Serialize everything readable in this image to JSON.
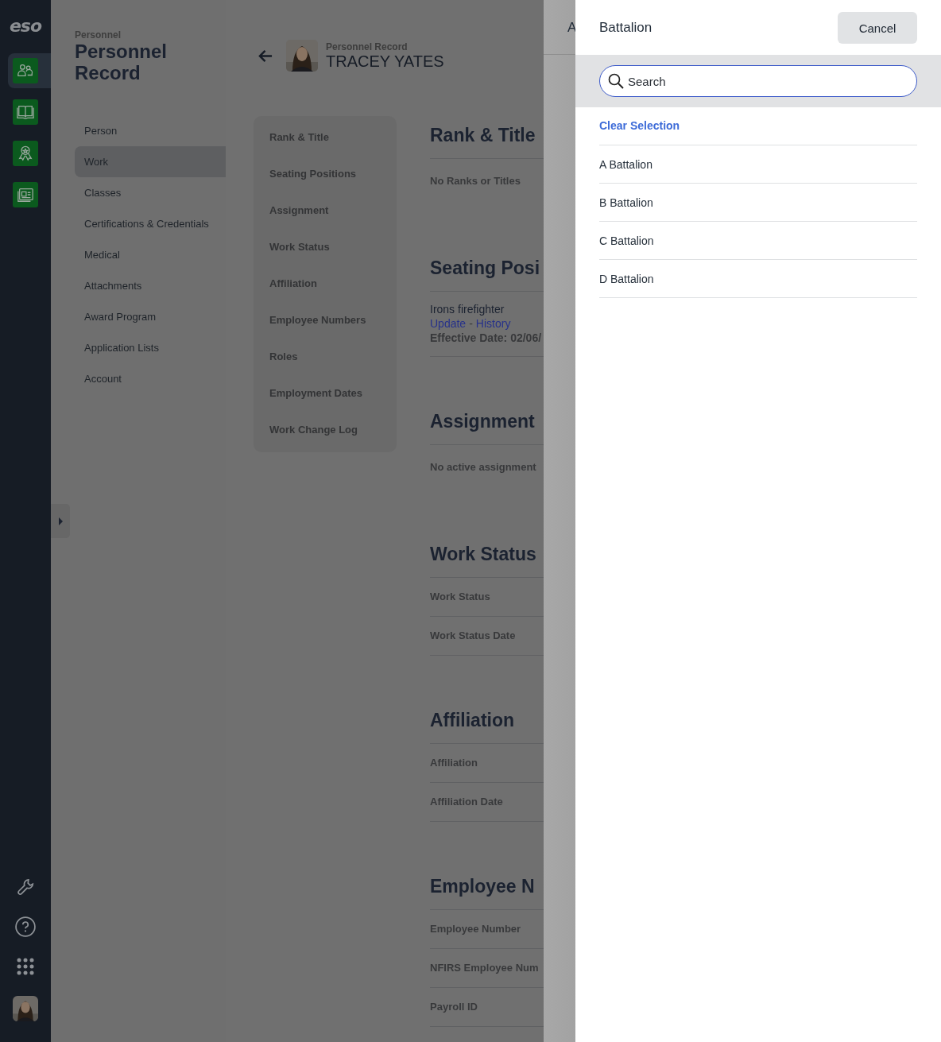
{
  "rail": {
    "logo": "eso",
    "apps": [
      {
        "selected": true
      },
      {
        "selected": false
      },
      {
        "selected": false
      },
      {
        "selected": false
      }
    ]
  },
  "subnav": {
    "eyebrow": "Personnel",
    "title": "Personnel Record",
    "items": [
      {
        "label": "Person",
        "selected": false
      },
      {
        "label": "Work",
        "selected": true
      },
      {
        "label": "Classes",
        "selected": false
      },
      {
        "label": "Certifications & Credentials",
        "selected": false
      },
      {
        "label": "Medical",
        "selected": false
      },
      {
        "label": "Attachments",
        "selected": false
      },
      {
        "label": "Award Program",
        "selected": false
      },
      {
        "label": "Application Lists",
        "selected": false
      },
      {
        "label": "Account",
        "selected": false
      }
    ]
  },
  "record": {
    "eyebrow": "Personnel Record",
    "name": "TRACEY YATES",
    "section_nav": [
      "Rank & Title",
      "Seating Positions",
      "Assignment",
      "Work Status",
      "Affiliation",
      "Employee Numbers",
      "Roles",
      "Employment Dates",
      "Work Change Log"
    ],
    "sections": [
      {
        "title": "Rank & Title",
        "kind": "message",
        "message": "No Ranks or Titles"
      },
      {
        "title": "Seating Posi",
        "kind": "entry",
        "name": "Irons firefighter",
        "links": [
          "Update",
          "History"
        ],
        "separator": "-",
        "effective": "Effective Date: 02/06/"
      },
      {
        "title": "Assignment",
        "kind": "message",
        "message": "No active assignment"
      },
      {
        "title": "Work Status",
        "kind": "fields",
        "fields": [
          "Work Status",
          "Work Status Date"
        ]
      },
      {
        "title": "Affiliation",
        "kind": "fields",
        "fields": [
          "Affiliation",
          "Affiliation Date"
        ]
      },
      {
        "title": "Employee N",
        "kind": "fields",
        "fields": [
          "Employee Number",
          "NFIRS Employee Num",
          "Payroll ID"
        ]
      }
    ]
  },
  "behind_panel": {
    "title": "A"
  },
  "drawer": {
    "title": "Battalion",
    "cancel": "Cancel",
    "search": {
      "placeholder": "Search"
    },
    "clear": "Clear Selection",
    "options": [
      "A Battalion",
      "B Battalion",
      "C Battalion",
      "D Battalion"
    ]
  }
}
